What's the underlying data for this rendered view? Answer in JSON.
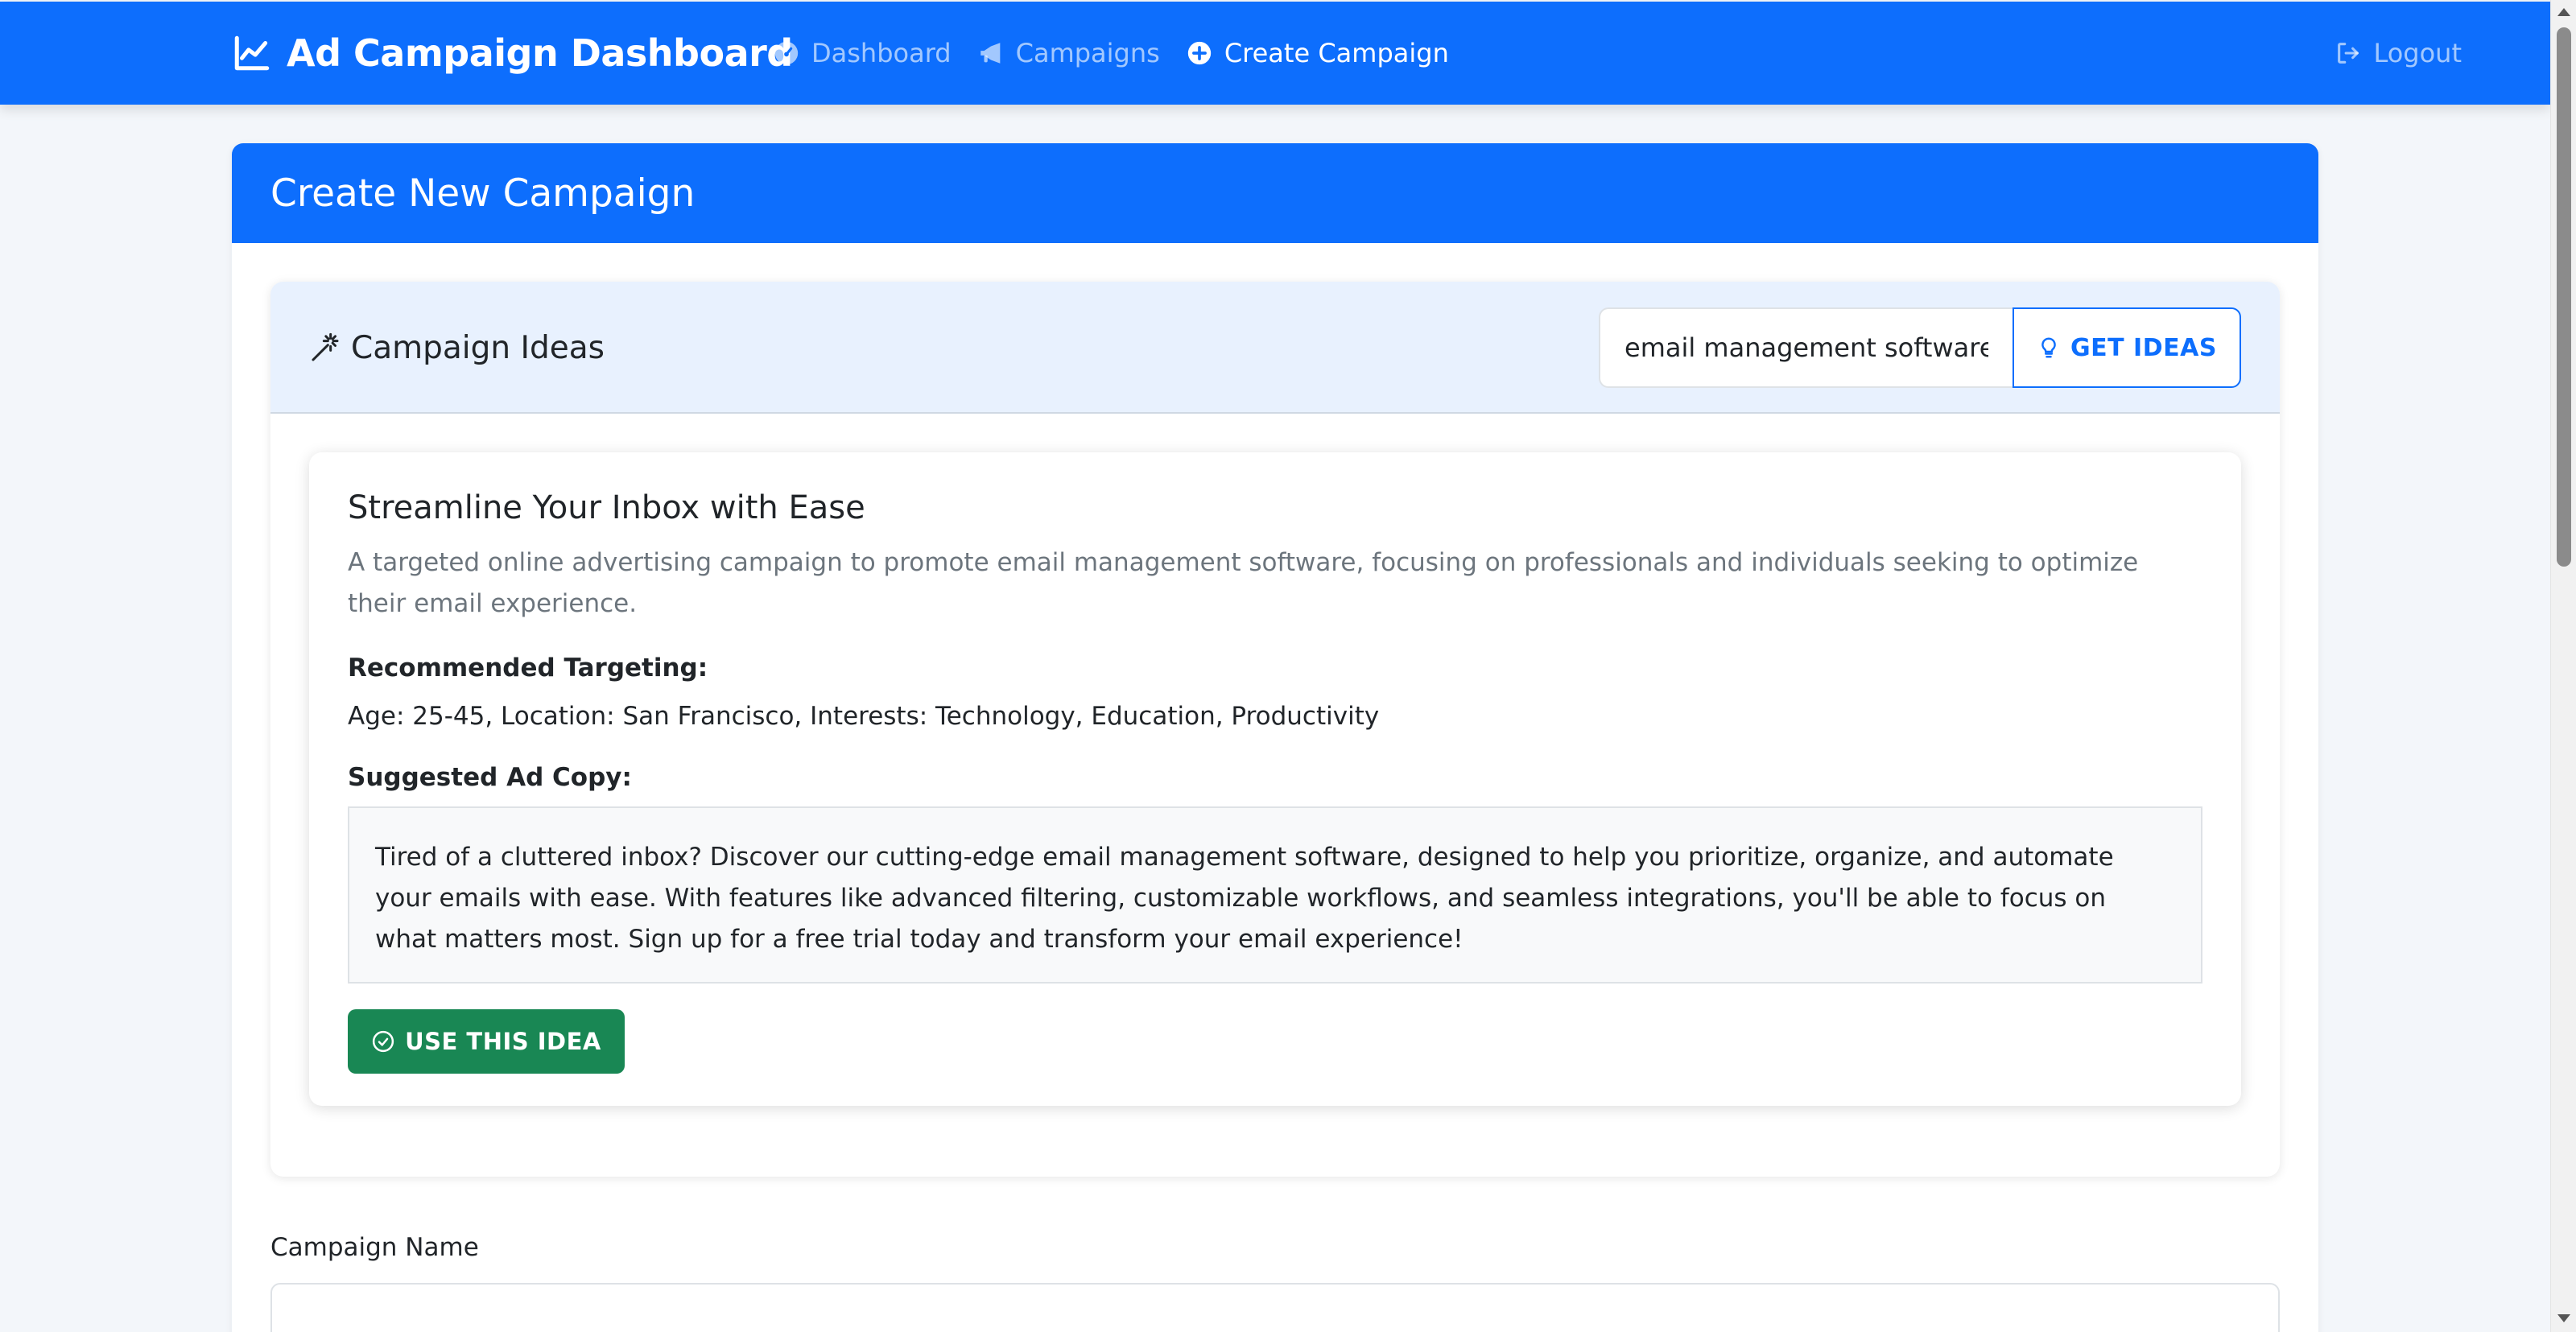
{
  "navbar": {
    "brand": "Ad Campaign Dashboard",
    "brand_icon": "chart-line-icon",
    "links": [
      {
        "label": "Dashboard",
        "icon": "speedometer-icon",
        "active": false
      },
      {
        "label": "Campaigns",
        "icon": "megaphone-icon",
        "active": false
      },
      {
        "label": "Create Campaign",
        "icon": "plus-circle-icon",
        "active": true
      }
    ],
    "logout": "Logout",
    "logout_icon": "logout-icon",
    "color": "#0d6efd"
  },
  "page": {
    "title": "Create New Campaign"
  },
  "ideas": {
    "title": "Campaign Ideas",
    "title_icon": "magic-wand-icon",
    "keyword_value": "email management software",
    "get_ideas_label": "GET IDEAS",
    "get_ideas_icon": "lightbulb-icon",
    "idea": {
      "title": "Streamline Your Inbox with Ease",
      "description": "A targeted online advertising campaign to promote email management software, focusing on professionals and individuals seeking to optimize their email experience.",
      "targeting_label": "Recommended Targeting:",
      "targeting_value": "Age: 25-45, Location: San Francisco, Interests: Technology, Education, Productivity",
      "ad_copy_label": "Suggested Ad Copy:",
      "ad_copy": "Tired of a cluttered inbox? Discover our cutting-edge email management software, designed to help you prioritize, organize, and automate your emails with ease. With features like advanced filtering, customizable workflows, and seamless integrations, you'll be able to focus on what matters most. Sign up for a free trial today and transform your email experience!",
      "use_label": "USE THIS IDEA",
      "use_icon": "check-circle-icon",
      "use_color": "#198754"
    }
  },
  "form": {
    "campaign_name_label": "Campaign Name",
    "campaign_name_value": ""
  }
}
